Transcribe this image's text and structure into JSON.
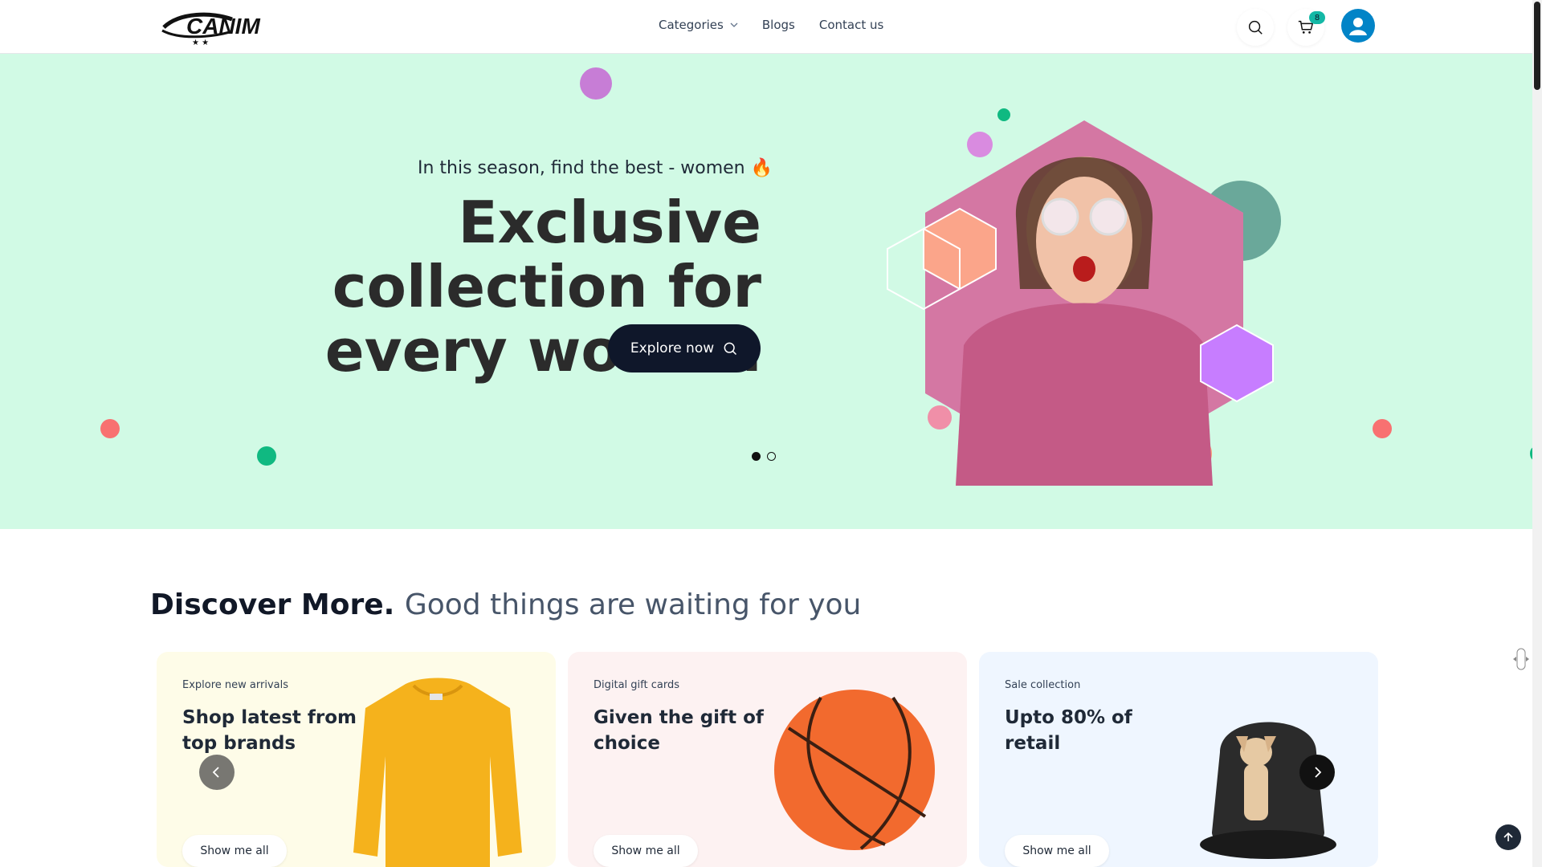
{
  "header": {
    "logo_text": "CANIM",
    "nav": [
      {
        "label": "Categories",
        "has_dropdown": true
      },
      {
        "label": "Blogs",
        "has_dropdown": false
      },
      {
        "label": "Contact us",
        "has_dropdown": false
      }
    ],
    "cart_count": "8",
    "icons": {
      "search": "search-icon",
      "cart": "cart-icon",
      "user": "user-icon"
    }
  },
  "hero": {
    "subtitle": "In this season, find the best - women",
    "title_line1": "Exclusive collection for",
    "title_line2": "every women",
    "cta_label": "Explore now",
    "slides_total": 2,
    "active_slide": 1,
    "background_color": "#d1fae5"
  },
  "discover": {
    "heading_strong": "Discover More.",
    "heading_muted": "Good things are waiting for you",
    "cards": [
      {
        "kicker": "Explore new arrivals",
        "title": "Shop latest from top brands",
        "button": "Show me all",
        "image": "yellow-sweater-icon"
      },
      {
        "kicker": "Digital gift cards",
        "title": "Given the gift of choice",
        "button": "Show me all",
        "image": "basketball-icon"
      },
      {
        "kicker": "Sale collection",
        "title": "Upto 80% of retail",
        "button": "Show me all",
        "image": "dog-carrier-icon"
      }
    ]
  },
  "colors": {
    "accent_dark": "#0f172a",
    "badge": "#14b8a6",
    "avatar": "#0284c7"
  }
}
